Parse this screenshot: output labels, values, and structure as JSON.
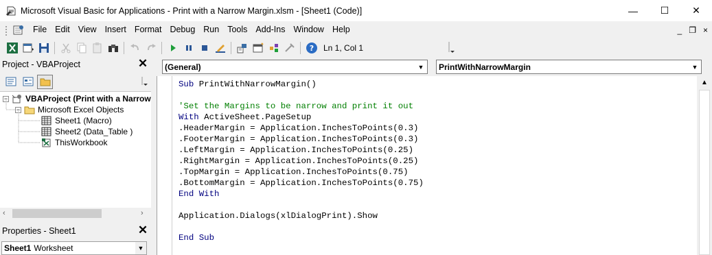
{
  "window": {
    "title": "Microsoft Visual Basic for Applications - Print with a Narrow Margin.xlsm - [Sheet1 (Code)]",
    "minimize_glyph": "—",
    "maximize_glyph": "☐",
    "close_glyph": "✕"
  },
  "menu": {
    "items": [
      "File",
      "Edit",
      "View",
      "Insert",
      "Format",
      "Debug",
      "Run",
      "Tools",
      "Add-Ins",
      "Window",
      "Help"
    ],
    "mdi_minimize": "_",
    "mdi_restore": "❐",
    "mdi_close": "×"
  },
  "toolbar": {
    "position": "Ln 1, Col 1"
  },
  "project": {
    "title": "Project - VBAProject",
    "tree": {
      "root": "VBAProject (Print with a Narrow",
      "folder": "Microsoft Excel Objects",
      "items": [
        "Sheet1 (Macro)",
        "Sheet2 (Data_Table )",
        "ThisWorkbook"
      ]
    }
  },
  "properties": {
    "title": "Properties - Sheet1",
    "selected_object": "Sheet1",
    "selected_type": "Worksheet"
  },
  "code": {
    "object_combo": "(General)",
    "proc_combo": "PrintWithNarrowMargin",
    "lines": [
      {
        "kind": "kw-mixed",
        "kw": "Sub",
        "rest": " PrintWithNarrowMargin()"
      },
      {
        "kind": "blank",
        "text": ""
      },
      {
        "kind": "comment",
        "text": "'Set the Margins to be narrow and print it out"
      },
      {
        "kind": "kw-mixed",
        "kw": "With",
        "rest": " ActiveSheet.PageSetup"
      },
      {
        "kind": "plain",
        "text": ".HeaderMargin = Application.InchesToPoints(0.3)"
      },
      {
        "kind": "plain",
        "text": ".FooterMargin = Application.InchesToPoints(0.3)"
      },
      {
        "kind": "plain",
        "text": ".LeftMargin = Application.InchesToPoints(0.25)"
      },
      {
        "kind": "plain",
        "text": ".RightMargin = Application.InchesToPoints(0.25)"
      },
      {
        "kind": "plain",
        "text": ".TopMargin = Application.InchesToPoints(0.75)"
      },
      {
        "kind": "plain",
        "text": ".BottomMargin = Application.InchesToPoints(0.75)"
      },
      {
        "kind": "keyword",
        "text": "End With"
      },
      {
        "kind": "blank",
        "text": ""
      },
      {
        "kind": "plain",
        "text": "Application.Dialogs(xlDialogPrint).Show"
      },
      {
        "kind": "blank",
        "text": ""
      },
      {
        "kind": "keyword",
        "text": "End Sub"
      }
    ]
  },
  "colors": {
    "keyword": "#00007f",
    "comment": "#007f00",
    "chrome": "#f0f0f0"
  }
}
